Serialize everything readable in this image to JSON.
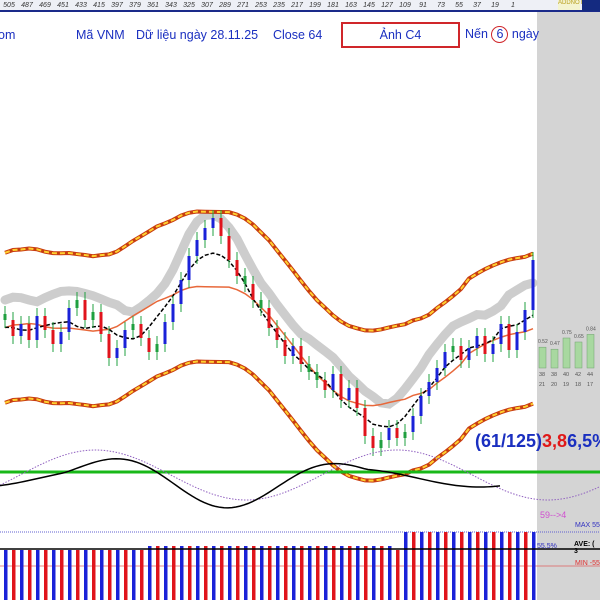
{
  "ruler": {
    "ticks": [
      "505",
      "487",
      "469",
      "451",
      "433",
      "415",
      "397",
      "379",
      "361",
      "343",
      "325",
      "307",
      "289",
      "271",
      "253",
      "235",
      "217",
      "199",
      "181",
      "163",
      "145",
      "127",
      "109",
      "91",
      "73",
      "55",
      "37",
      "19",
      "1"
    ],
    "addnote": "ADDNOTE"
  },
  "header": {
    "left": "om",
    "symbol": "Mã VNM",
    "date": "Dữ liệu ngày 28.11.25",
    "close": "Close 64",
    "image_button": "Ảnh C4",
    "candles_prefix": "Nến",
    "candles_count": "6",
    "candles_suffix": "ngày"
  },
  "colors": {
    "up": "#1a22d8",
    "down": "#e0141c",
    "band": "#f07a10",
    "ma": "#e8683a",
    "signal": "#18b818"
  },
  "chart_data": {
    "type": "candlestick",
    "closes": [
      61,
      60.2,
      60.8,
      60,
      61.2,
      60.5,
      59.8,
      60.4,
      61.6,
      62,
      61,
      61.4,
      60.3,
      59.1,
      59.6,
      60.5,
      60.8,
      60.1,
      59.4,
      59.8,
      60.9,
      61.8,
      63,
      64.2,
      65,
      65.6,
      66.1,
      65.2,
      64,
      63.2,
      62.8,
      62,
      61.6,
      60.6,
      60,
      59.2,
      59.7,
      58.8,
      58.4,
      58,
      57.5,
      58.3,
      57,
      57.6,
      56.6,
      55.2,
      54.6,
      55,
      55.6,
      55.1,
      55.4,
      56.2,
      57.2,
      57.9,
      58.6,
      59.4,
      59.7,
      59,
      59.6,
      60.2,
      59.3,
      59.8,
      60.8,
      59.5,
      60.4,
      61.5,
      64
    ],
    "mini_bars": {
      "values": [
        0.52,
        0.47,
        0.75,
        0.65,
        0.84
      ],
      "labels_top": [
        "38",
        "38",
        "40",
        "42",
        "44"
      ],
      "labels_bottom": [
        "21",
        "20",
        "19",
        "18",
        "17"
      ]
    },
    "annotation": {
      "ratio": "(61/125)",
      "red": "3,8",
      "blue": "6,5%"
    },
    "oscillator_label": "59-->4",
    "histogram": {
      "max_label": "MAX 55",
      "ave_label": "AVE: ( 3",
      "min_label": "MIN -55",
      "pct": "55,5%"
    }
  }
}
